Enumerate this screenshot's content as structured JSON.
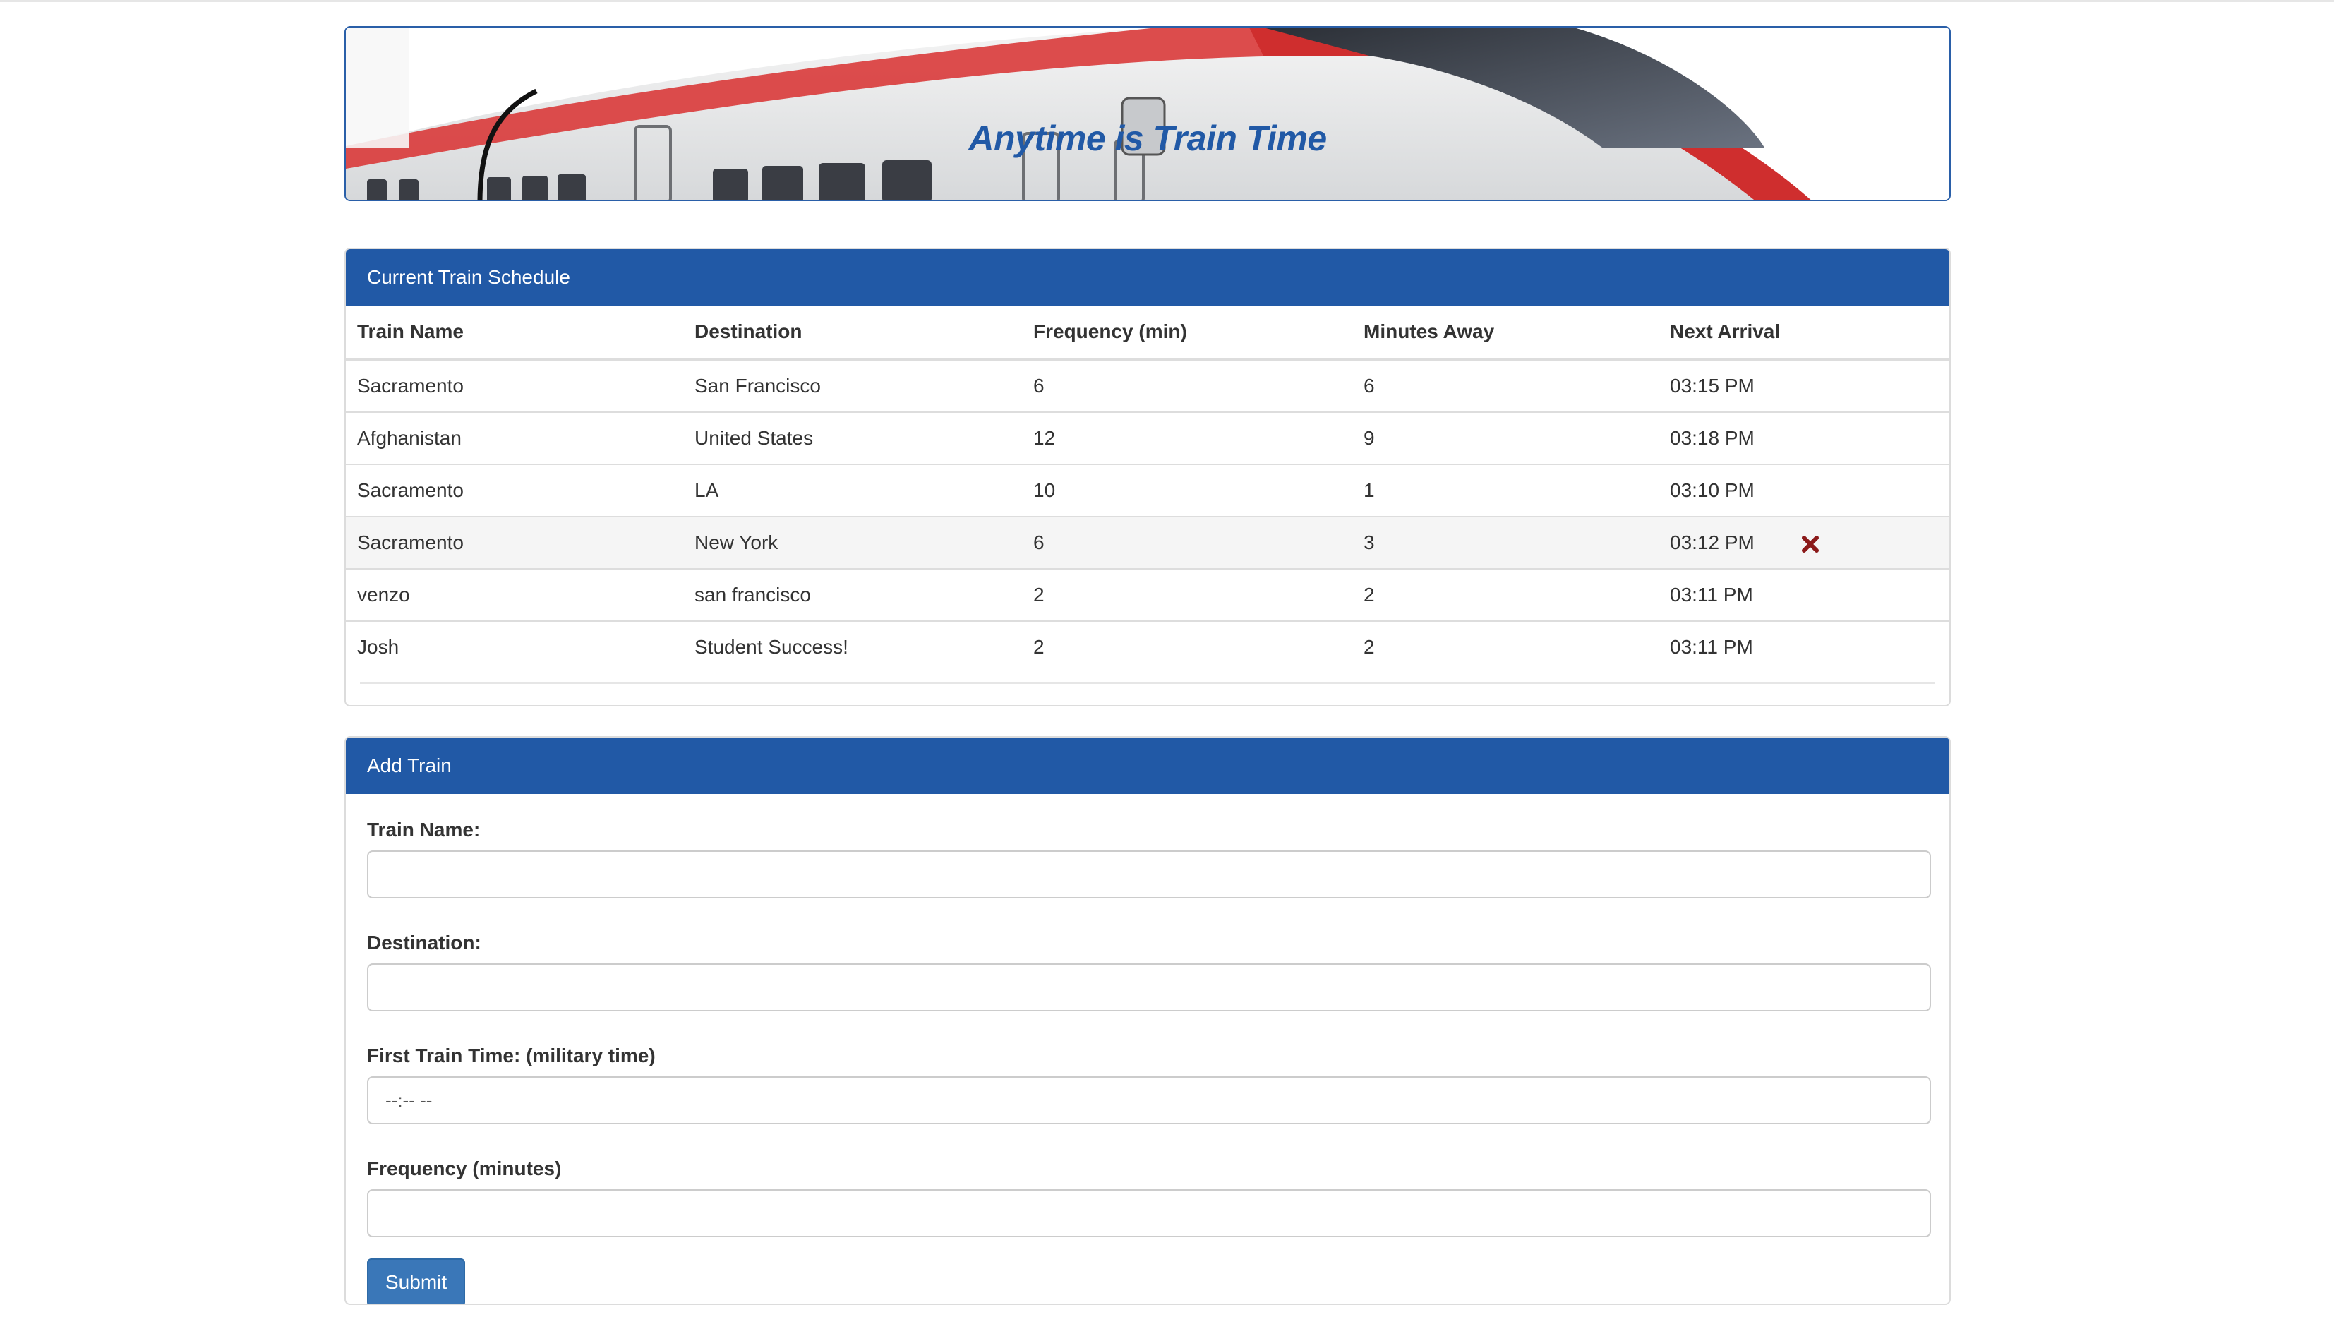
{
  "banner": {
    "title": "Anytime is Train Time"
  },
  "schedule": {
    "heading": "Current Train Schedule",
    "columns": [
      "Train Name",
      "Destination",
      "Frequency (min)",
      "Minutes Away",
      "Next Arrival"
    ],
    "rows": [
      {
        "name": "Sacramento",
        "destination": "San Francisco",
        "frequency": "6",
        "minutes_away": "6",
        "next_arrival": "03:15 PM"
      },
      {
        "name": "Afghanistan",
        "destination": "United States",
        "frequency": "12",
        "minutes_away": "9",
        "next_arrival": "03:18 PM"
      },
      {
        "name": "Sacramento",
        "destination": "LA",
        "frequency": "10",
        "minutes_away": "1",
        "next_arrival": "03:10 PM"
      },
      {
        "name": "Sacramento",
        "destination": "New York",
        "frequency": "6",
        "minutes_away": "3",
        "next_arrival": "03:12 PM"
      },
      {
        "name": "venzo",
        "destination": "san francisco",
        "frequency": "2",
        "minutes_away": "2",
        "next_arrival": "03:11 PM"
      },
      {
        "name": "Josh",
        "destination": "Student Success!",
        "frequency": "2",
        "minutes_away": "2",
        "next_arrival": "03:11 PM"
      }
    ],
    "remove_icon": "times-icon",
    "remove_icon_color": "#8b1a1a"
  },
  "add_train": {
    "heading": "Add Train",
    "train_name_label": "Train Name:",
    "train_name_value": "",
    "destination_label": "Destination:",
    "destination_value": "",
    "first_time_label": "First Train Time: (military time)",
    "first_time_placeholder": "--:-- --",
    "frequency_label": "Frequency (minutes)",
    "frequency_value": "",
    "submit_label": "Submit"
  },
  "colors": {
    "accent": "#2159a6",
    "button": "#3a77b8"
  }
}
